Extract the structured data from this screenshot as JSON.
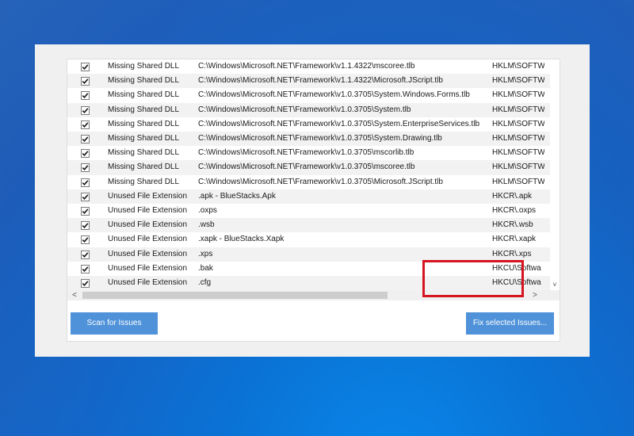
{
  "rows": [
    {
      "checked": true,
      "type": "Missing Shared DLL",
      "path": "C:\\Windows\\Microsoft.NET\\Framework\\v1.1.4322\\mscoree.tlb",
      "key": "HKLM\\SOFTW"
    },
    {
      "checked": true,
      "type": "Missing Shared DLL",
      "path": "C:\\Windows\\Microsoft.NET\\Framework\\v1.1.4322\\Microsoft.JScript.tlb",
      "key": "HKLM\\SOFTW"
    },
    {
      "checked": true,
      "type": "Missing Shared DLL",
      "path": "C:\\Windows\\Microsoft.NET\\Framework\\v1.0.3705\\System.Windows.Forms.tlb",
      "key": "HKLM\\SOFTW"
    },
    {
      "checked": true,
      "type": "Missing Shared DLL",
      "path": "C:\\Windows\\Microsoft.NET\\Framework\\v1.0.3705\\System.tlb",
      "key": "HKLM\\SOFTW"
    },
    {
      "checked": true,
      "type": "Missing Shared DLL",
      "path": "C:\\Windows\\Microsoft.NET\\Framework\\v1.0.3705\\System.EnterpriseServices.tlb",
      "key": "HKLM\\SOFTW"
    },
    {
      "checked": true,
      "type": "Missing Shared DLL",
      "path": "C:\\Windows\\Microsoft.NET\\Framework\\v1.0.3705\\System.Drawing.tlb",
      "key": "HKLM\\SOFTW"
    },
    {
      "checked": true,
      "type": "Missing Shared DLL",
      "path": "C:\\Windows\\Microsoft.NET\\Framework\\v1.0.3705\\mscorlib.tlb",
      "key": "HKLM\\SOFTW"
    },
    {
      "checked": true,
      "type": "Missing Shared DLL",
      "path": "C:\\Windows\\Microsoft.NET\\Framework\\v1.0.3705\\mscoree.tlb",
      "key": "HKLM\\SOFTW"
    },
    {
      "checked": true,
      "type": "Missing Shared DLL",
      "path": "C:\\Windows\\Microsoft.NET\\Framework\\v1.0.3705\\Microsoft.JScript.tlb",
      "key": "HKLM\\SOFTW"
    },
    {
      "checked": true,
      "type": "Unused File Extension",
      "path": ".apk - BlueStacks.Apk",
      "key": "HKCR\\.apk"
    },
    {
      "checked": true,
      "type": "Unused File Extension",
      "path": ".oxps",
      "key": "HKCR\\.oxps"
    },
    {
      "checked": true,
      "type": "Unused File Extension",
      "path": ".wsb",
      "key": "HKCR\\.wsb"
    },
    {
      "checked": true,
      "type": "Unused File Extension",
      "path": ".xapk - BlueStacks.Xapk",
      "key": "HKCR\\.xapk"
    },
    {
      "checked": true,
      "type": "Unused File Extension",
      "path": ".xps",
      "key": "HKCR\\.xps"
    },
    {
      "checked": true,
      "type": "Unused File Extension",
      "path": ".bak",
      "key": "HKCU\\Softwa"
    },
    {
      "checked": true,
      "type": "Unused File Extension",
      "path": ".cfg",
      "key": "HKCU\\Softwa"
    }
  ],
  "buttons": {
    "scan": "Scan for Issues",
    "fix": "Fix selected Issues..."
  },
  "scroll": {
    "left_arrow": "<",
    "right_arrow": ">",
    "down_arrow": "˅"
  },
  "colors": {
    "button": "#4f92d9",
    "highlight": "#d6141f",
    "desktop": "#0b6fd0"
  }
}
